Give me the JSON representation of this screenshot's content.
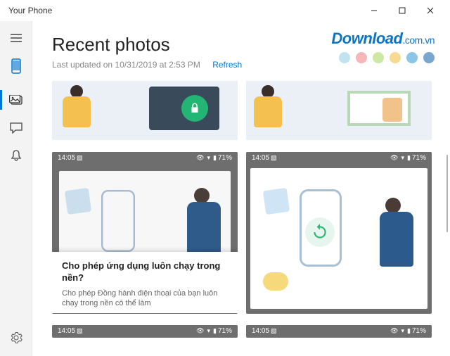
{
  "window": {
    "title": "Your Phone"
  },
  "sidebar": {
    "items": [
      {
        "id": "hamburger"
      },
      {
        "id": "phone"
      },
      {
        "id": "photos"
      },
      {
        "id": "messages"
      },
      {
        "id": "notifications"
      }
    ],
    "selected_index": 2,
    "settings_id": "settings"
  },
  "page": {
    "title": "Recent photos",
    "last_updated": "Last updated on 10/31/2019 at 2:53 PM",
    "refresh_label": "Refresh"
  },
  "watermark": {
    "text_main": "Download",
    "text_suffix": ".com.vn",
    "dot_colors": [
      "#bfe3ef",
      "#f5b7b7",
      "#cde8a2",
      "#f7da8f",
      "#8bc6e6",
      "#7aa5cf"
    ]
  },
  "status": {
    "time": "14:05",
    "battery": "71%"
  },
  "dialog": {
    "title": "Cho phép ứng dụng luôn chạy trong nền?",
    "body": "Cho phép Đồng hành điện thoại của bạn luôn chạy trong nền có thể làm"
  }
}
